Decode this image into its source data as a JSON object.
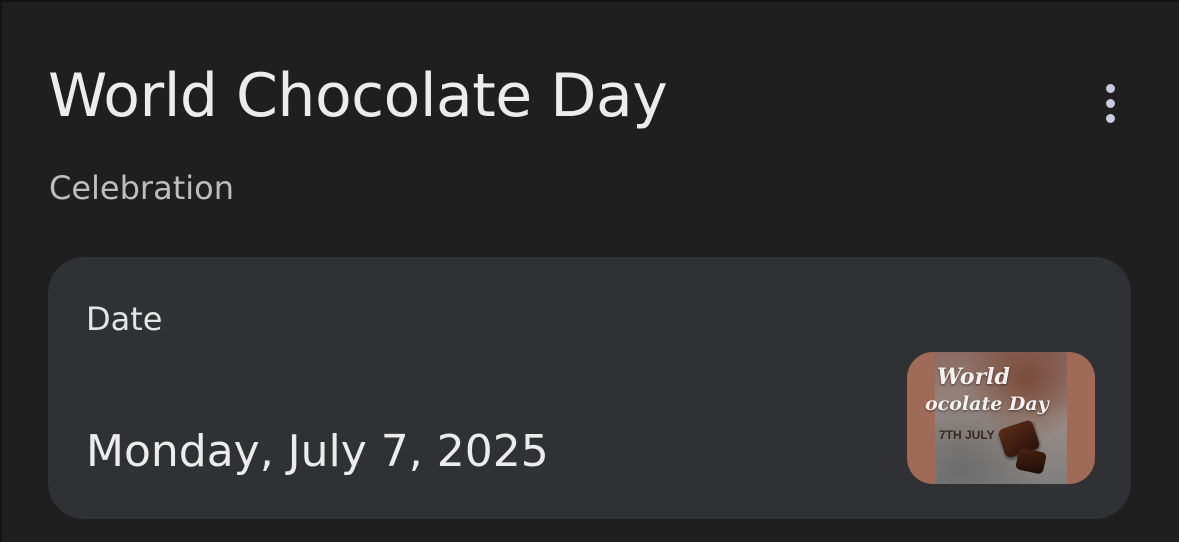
{
  "header": {
    "title": "World Chocolate Day",
    "subtitle": "Celebration",
    "more_icon": "more-vert-icon"
  },
  "date_card": {
    "label": "Date",
    "value": "Monday, July 7, 2025",
    "thumbnail": {
      "line1": "World",
      "line2": "ocolate Day",
      "line3": "7TH JULY"
    }
  },
  "colors": {
    "background": "#1f1f1f",
    "card": "#303134",
    "thumbnail_frame": "#a06a58",
    "icon": "#c8cbe0"
  }
}
